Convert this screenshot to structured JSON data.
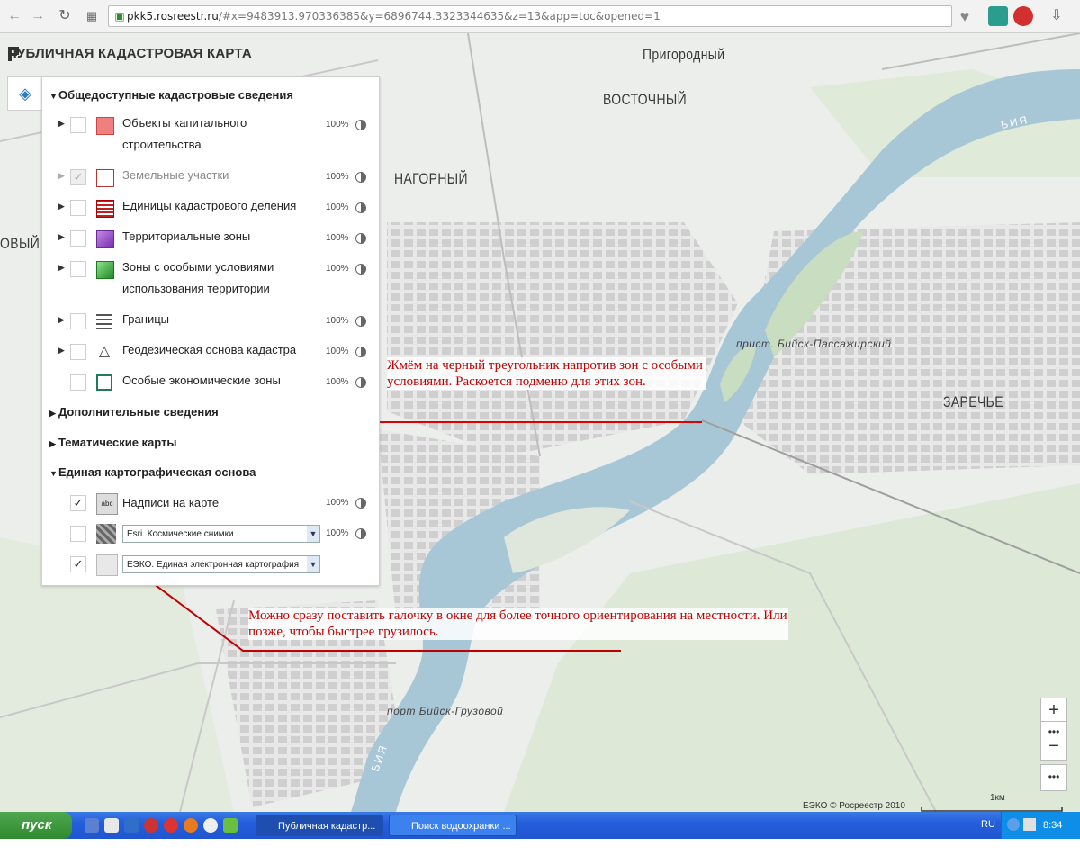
{
  "browser": {
    "url_domain": "pkk5.rosreestr.ru",
    "url_rest": "/#x=9483913.970336385&y=6896744.3323344635&z=13&app=toc&opened=1"
  },
  "app": {
    "title": "ПУБЛИЧНАЯ КАДАСТРОВАЯ КАРТА"
  },
  "map": {
    "places": [
      "Пригородный",
      "ВОСТОЧНЫЙ",
      "НАГОРНЫЙ",
      "ЗАРЕЧЬЕ",
      "ОВЫЙ"
    ],
    "piers": [
      "прист. Бийск-Пассажирский",
      "порт Бийск-Грузовой"
    ],
    "river": "БИЯ",
    "copyright": "ЕЭКО © Росреестр 2010",
    "scale_label": "1км"
  },
  "panel": {
    "section_public": "Общедоступные кадастровые сведения",
    "layers": [
      {
        "label1": "Объекты капитального",
        "label2": "строительства",
        "pct": "100%",
        "color": "#f08080"
      },
      {
        "label1": "Земельные участки",
        "label2": "",
        "pct": "100%",
        "color": "#ffffff"
      },
      {
        "label1": "Единицы кадастрового деления",
        "label2": "",
        "pct": "100%",
        "color": "#c02020"
      },
      {
        "label1": "Территориальные зоны",
        "label2": "",
        "pct": "100%",
        "color": "#9b4fc9"
      },
      {
        "label1": "Зоны с особыми условиями",
        "label2": "использования территории",
        "pct": "100%",
        "color": "#3fae3f"
      },
      {
        "label1": "Границы",
        "label2": "",
        "pct": "100%",
        "color": "#777777"
      },
      {
        "label1": "Геодезическая основа кадастра",
        "label2": "",
        "pct": "100%",
        "color": "#444444"
      },
      {
        "label1": "Особые экономические зоны",
        "label2": "",
        "pct": "100%",
        "color": "#1f7a5a"
      }
    ],
    "section_additional": "Дополнительные сведения",
    "section_thematic": "Тематические карты",
    "section_base": "Единая картографическая основа",
    "base": {
      "labels_layer": "Надписи на карте",
      "labels_pct": "100%",
      "imagery_select": "Esri. Космические снимки",
      "imagery_pct": "100%",
      "eeko_select": "ЕЭКО. Единая электронная картография"
    }
  },
  "annotations": {
    "note1": "Жмём на черный треугольник напротив зон с особыми условиями. Раскоется подменю для этих зон.",
    "note2": "Можно сразу поставить галочку в окне для более точного ориентирования на местности. Или позже, чтобы быстрее грузилось."
  },
  "taskbar": {
    "start": "пуск",
    "task1": "Публичная кадастр...",
    "task2": "Поиск водоохранки ...",
    "lang": "RU",
    "time": "8:34"
  }
}
